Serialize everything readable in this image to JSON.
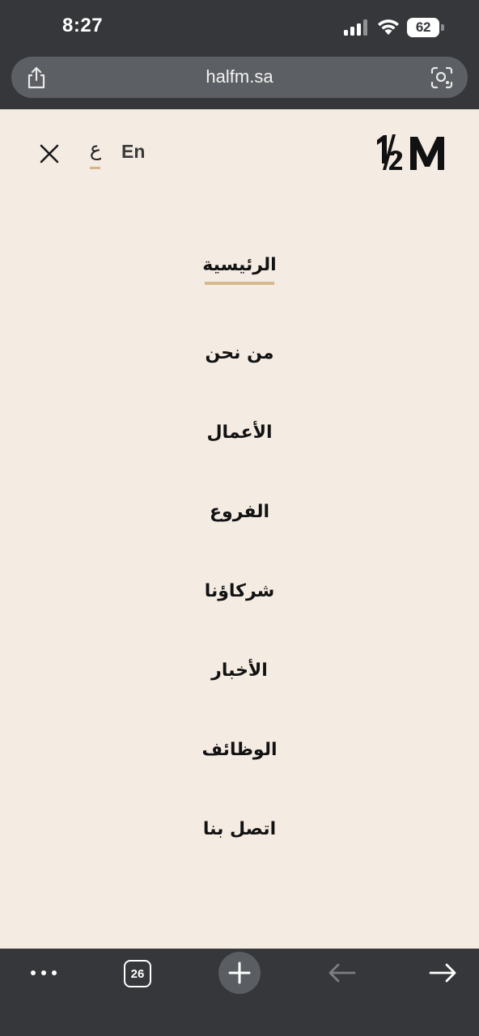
{
  "status_bar": {
    "time": "8:27",
    "battery_level": "62",
    "icons": [
      "signal-icon",
      "wifi-icon",
      "battery-icon"
    ]
  },
  "browser": {
    "url": "halfm.sa",
    "tab_count": "26",
    "icons": [
      "share-icon",
      "lens-icon",
      "more-icon",
      "plus-icon",
      "back-arrow-icon",
      "forward-arrow-icon"
    ]
  },
  "header": {
    "lang_ar": "ع",
    "lang_en": "En",
    "logo_text": "½M",
    "close_icon": "close-icon"
  },
  "menu": {
    "active_index": 0,
    "items": [
      {
        "label": "الرئيسية"
      },
      {
        "label": "من نحن"
      },
      {
        "label": "الأعمال"
      },
      {
        "label": "الفروع"
      },
      {
        "label": "شركاؤنا"
      },
      {
        "label": "الأخبار"
      },
      {
        "label": "الوظائف"
      },
      {
        "label": "اتصل بنا"
      }
    ]
  },
  "colors": {
    "page_background": "#f4ebe3",
    "chrome_background": "#35373a",
    "accent_underline": "#d6b98f",
    "text": "#121212"
  }
}
